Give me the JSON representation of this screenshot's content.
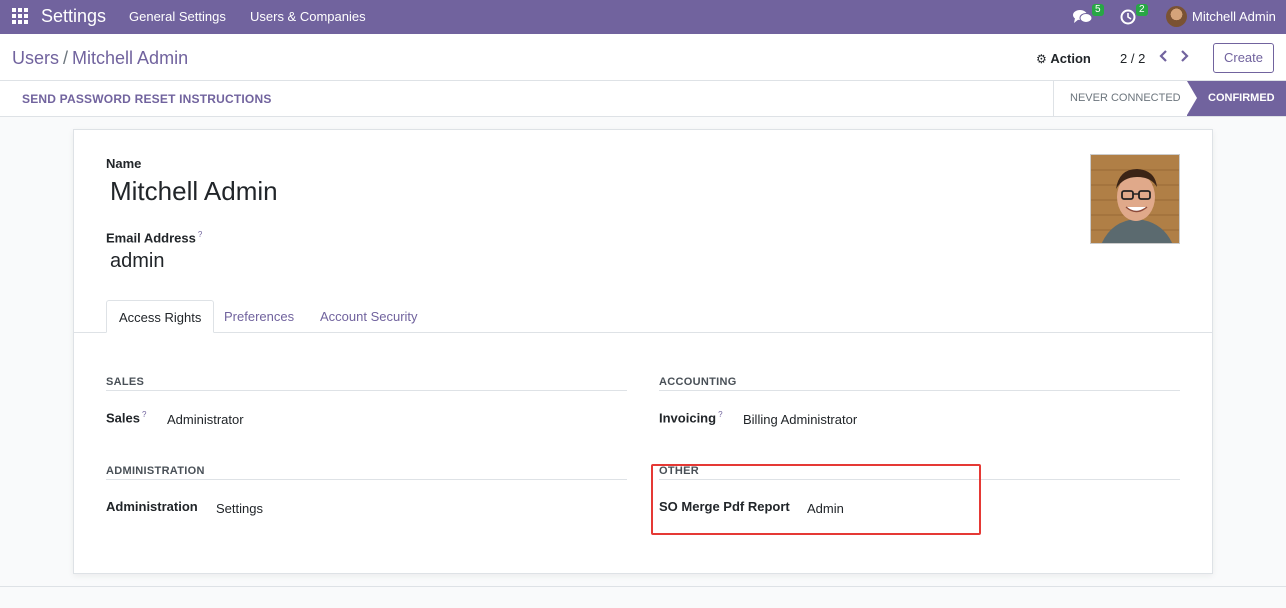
{
  "navbar": {
    "app_title": "Settings",
    "menu": [
      "General Settings",
      "Users & Companies"
    ],
    "messages_count": "5",
    "activities_count": "2",
    "user_name": "Mitchell Admin"
  },
  "control_panel": {
    "breadcrumb_parent": "Users",
    "breadcrumb_separator": "/",
    "breadcrumb_current": "Mitchell Admin",
    "action_label": "Action",
    "pager": "2 / 2",
    "create_label": "Create"
  },
  "statusbar": {
    "reset_button": "SEND PASSWORD RESET INSTRUCTIONS",
    "stages": [
      "NEVER CONNECTED",
      "CONFIRMED"
    ],
    "current_stage": "CONFIRMED"
  },
  "form": {
    "name_label": "Name",
    "name_value": "Mitchell Admin",
    "email_label": "Email Address",
    "email_help": "?",
    "email_value": "admin",
    "tabs": [
      "Access Rights",
      "Preferences",
      "Account Security"
    ],
    "active_tab": "Access Rights",
    "sections": {
      "sales": {
        "title": "SALES",
        "field_label": "Sales",
        "help": "?",
        "value": "Administrator"
      },
      "accounting": {
        "title": "ACCOUNTING",
        "field_label": "Invoicing",
        "help": "?",
        "value": "Billing Administrator"
      },
      "administration": {
        "title": "ADMINISTRATION",
        "field_label": "Administration",
        "value": "Settings"
      },
      "other": {
        "title": "OTHER",
        "field_label": "SO Merge Pdf Report",
        "value": "Admin"
      }
    }
  },
  "colors": {
    "brand": "#71639e",
    "badge": "#28a745",
    "highlight": "#e53935"
  }
}
